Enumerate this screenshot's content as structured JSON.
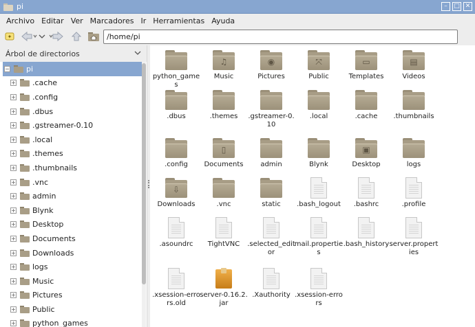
{
  "window": {
    "title": "pi"
  },
  "menu": [
    "Archivo",
    "Editar",
    "Ver",
    "Marcadores",
    "Ir",
    "Herramientas",
    "Ayuda"
  ],
  "toolbar": {
    "path": "/home/pi"
  },
  "sidebar": {
    "header": "Árbol de directorios",
    "root": "pi",
    "items": [
      ".cache",
      ".config",
      ".dbus",
      ".gstreamer-0.10",
      ".local",
      ".themes",
      ".thumbnails",
      ".vnc",
      "admin",
      "Blynk",
      "Desktop",
      "Documents",
      "Downloads",
      "logs",
      "Music",
      "Pictures",
      "Public",
      "python_games"
    ]
  },
  "files": [
    {
      "label": "python_games",
      "type": "folder",
      "emblem": ""
    },
    {
      "label": "Music",
      "type": "folder",
      "emblem": "♫"
    },
    {
      "label": "Pictures",
      "type": "folder",
      "emblem": "◉"
    },
    {
      "label": "Public",
      "type": "folder",
      "emblem": "⤧"
    },
    {
      "label": "Templates",
      "type": "folder",
      "emblem": "▭"
    },
    {
      "label": "Videos",
      "type": "folder",
      "emblem": "▤"
    },
    {
      "label": ".dbus",
      "type": "folder",
      "emblem": ""
    },
    {
      "label": ".themes",
      "type": "folder",
      "emblem": ""
    },
    {
      "label": ".gstreamer-0.10",
      "type": "folder",
      "emblem": ""
    },
    {
      "label": ".local",
      "type": "folder",
      "emblem": ""
    },
    {
      "label": ".cache",
      "type": "folder",
      "emblem": ""
    },
    {
      "label": ".thumbnails",
      "type": "folder",
      "emblem": ""
    },
    {
      "label": ".config",
      "type": "folder",
      "emblem": ""
    },
    {
      "label": "Documents",
      "type": "folder",
      "emblem": "▯"
    },
    {
      "label": "admin",
      "type": "folder",
      "emblem": ""
    },
    {
      "label": "Blynk",
      "type": "folder",
      "emblem": ""
    },
    {
      "label": "Desktop",
      "type": "folder",
      "emblem": "▣"
    },
    {
      "label": "logs",
      "type": "folder",
      "emblem": ""
    },
    {
      "label": "Downloads",
      "type": "folder",
      "emblem": "⇩"
    },
    {
      "label": ".vnc",
      "type": "folder",
      "emblem": ""
    },
    {
      "label": "static",
      "type": "folder",
      "emblem": ""
    },
    {
      "label": ".bash_logout",
      "type": "file",
      "emblem": ""
    },
    {
      "label": ".bashrc",
      "type": "file",
      "emblem": ""
    },
    {
      "label": ".profile",
      "type": "file",
      "emblem": ""
    },
    {
      "label": ".asoundrc",
      "type": "file",
      "emblem": ""
    },
    {
      "label": "TightVNC",
      "type": "file",
      "emblem": ""
    },
    {
      "label": ".selected_editor",
      "type": "file",
      "emblem": ""
    },
    {
      "label": "mail.properties",
      "type": "file",
      "emblem": ""
    },
    {
      "label": ".bash_history",
      "type": "file",
      "emblem": ""
    },
    {
      "label": "server.properties",
      "type": "file",
      "emblem": ""
    },
    {
      "label": ".xsession-errors.old",
      "type": "file",
      "emblem": ""
    },
    {
      "label": "server-0.16.2.jar",
      "type": "jar",
      "emblem": ""
    },
    {
      "label": ".Xauthority",
      "type": "file",
      "emblem": ""
    },
    {
      "label": ".xsession-errors",
      "type": "file",
      "emblem": ""
    }
  ]
}
